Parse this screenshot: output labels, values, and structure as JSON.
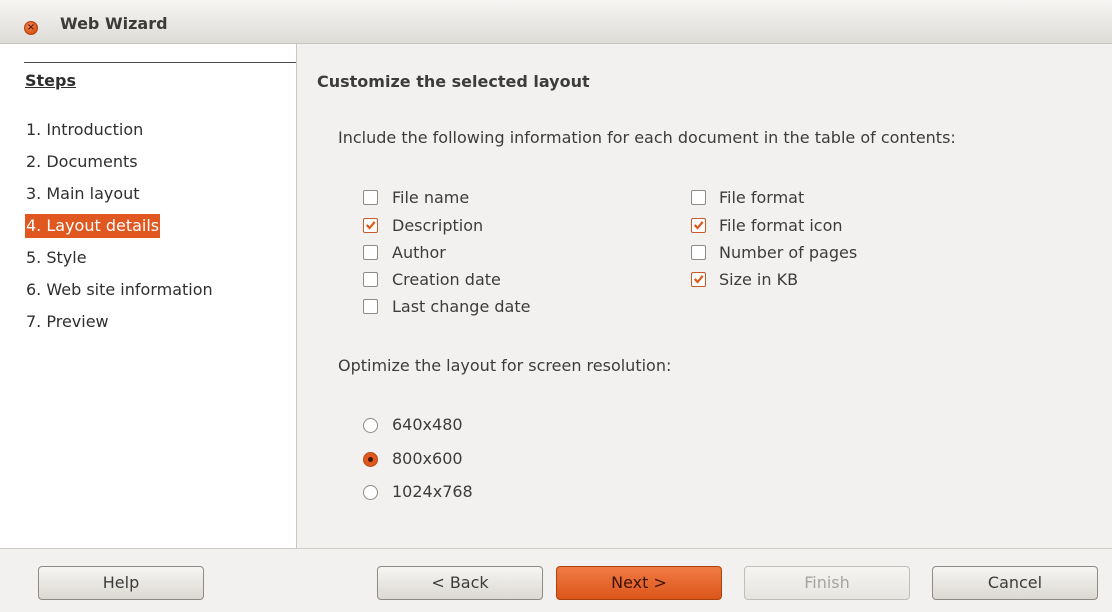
{
  "window": {
    "title": "Web Wizard"
  },
  "steps": {
    "heading": "Steps",
    "items": [
      {
        "label": "1. Introduction"
      },
      {
        "label": "2. Documents"
      },
      {
        "label": "3. Main layout"
      },
      {
        "label": "4. Layout details"
      },
      {
        "label": "5. Style"
      },
      {
        "label": "6. Web site information"
      },
      {
        "label": "7. Preview"
      }
    ]
  },
  "content": {
    "title": "Customize the selected layout",
    "include_text": "Include the following information for each document in the table of contents:",
    "checkboxes_left": [
      {
        "label": "File name",
        "checked": false
      },
      {
        "label": "Description",
        "checked": true
      },
      {
        "label": "Author",
        "checked": false
      },
      {
        "label": "Creation date",
        "checked": false
      },
      {
        "label": "Last change date",
        "checked": false
      }
    ],
    "checkboxes_right": [
      {
        "label": "File format",
        "checked": false
      },
      {
        "label": "File format icon",
        "checked": true
      },
      {
        "label": "Number of pages",
        "checked": false
      },
      {
        "label": "Size in KB",
        "checked": true
      }
    ],
    "resolution_text": "Optimize the layout for screen resolution:",
    "resolutions": [
      {
        "label": "640x480",
        "selected": false
      },
      {
        "label": "800x600",
        "selected": true
      },
      {
        "label": "1024x768",
        "selected": false
      }
    ]
  },
  "buttons": {
    "help": "Help",
    "back": "< Back",
    "next": "Next >",
    "finish": "Finish",
    "cancel": "Cancel"
  },
  "colors": {
    "accent": "#e0571f",
    "window_bg": "#f2f1f0"
  }
}
